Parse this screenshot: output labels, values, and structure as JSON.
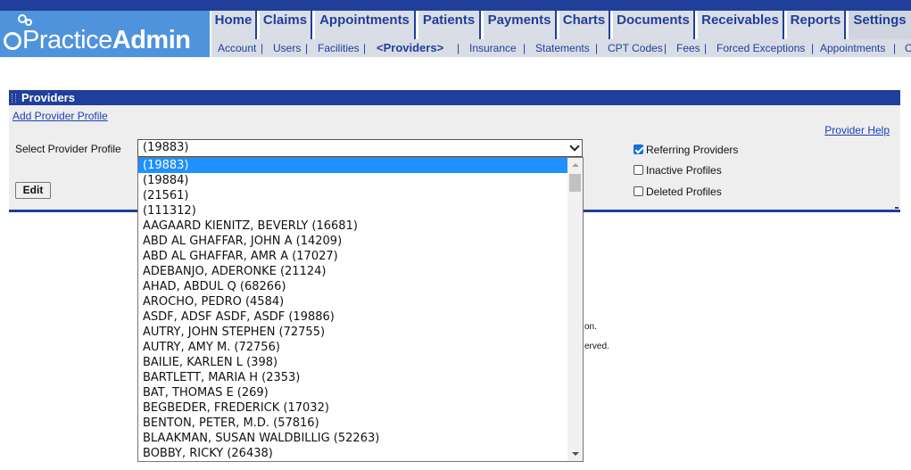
{
  "brand": {
    "name_regular": "Practice",
    "name_bold": "Admin"
  },
  "nav": {
    "tabs": [
      "Home",
      "Claims",
      "Appointments",
      "Patients",
      "Payments",
      "Charts",
      "Documents",
      "Receivables",
      "Reports",
      "Settings"
    ],
    "active_tab": "Settings",
    "subnav": [
      "Account",
      "Users",
      "Facilities",
      "<Providers>",
      "Insurance",
      "Statements",
      "CPT Codes",
      "Fees",
      "Forced Exceptions",
      "Appointments",
      "C"
    ],
    "active_subnav": "<Providers>"
  },
  "panel": {
    "title": "Providers",
    "add_link": "Add Provider Profile",
    "help_link": "Provider Help",
    "select_label": "Select Provider Profile",
    "selected_value": "(19883)",
    "edit_button": "Edit",
    "checkboxes": [
      {
        "label": "Referring Providers",
        "checked": true
      },
      {
        "label": "Inactive Profiles",
        "checked": false
      },
      {
        "label": "Deleted Profiles",
        "checked": false
      }
    ]
  },
  "background_fragments": [
    "on.",
    "erved."
  ],
  "dropdown": {
    "options": [
      "(19883)",
      "(19884)",
      "(21561)",
      "(111312)",
      "AAGAARD KIENITZ, BEVERLY (16681)",
      "ABD AL GHAFFAR, JOHN A (14209)",
      "ABD AL GHAFFAR, AMR A (17027)",
      "ADEBANJO, ADERONKE (21124)",
      "AHAD, ABDUL Q (68266)",
      "AROCHO, PEDRO (4584)",
      "ASDF, ADSF ASDF, ASDF (19886)",
      "AUTRY, JOHN STEPHEN (72755)",
      "AUTRY, AMY M. (72756)",
      "BAILIE, KARLEN L (398)",
      "BARTLETT, MARIA H (2353)",
      "BAT, THOMAS E (269)",
      "BEGBEDER, FREDERICK (17032)",
      "BENTON, PETER, M.D. (57816)",
      "BLAAKMAN, SUSAN WALDBILLIG (52263)",
      "BOBBY, RICKY (26438)"
    ],
    "highlighted_index": 0
  }
}
